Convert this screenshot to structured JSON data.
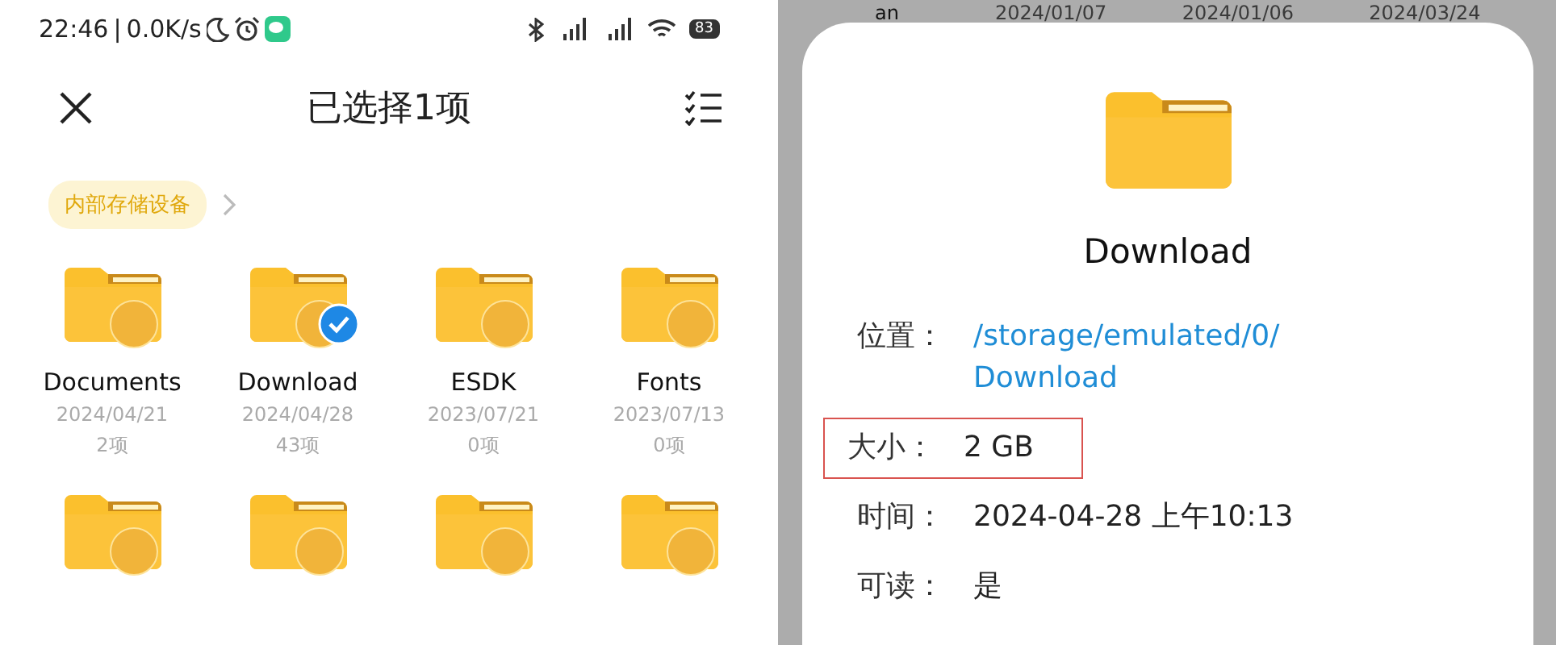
{
  "status_bar": {
    "time": "22:46",
    "separator": "|",
    "speed": "0.0K/s",
    "battery": "83"
  },
  "header": {
    "title": "已选择1项"
  },
  "breadcrumb": {
    "label": "内部存储设备"
  },
  "folders": [
    {
      "name": "Documents",
      "date": "2024/04/21",
      "count": "2项",
      "selected": false
    },
    {
      "name": "Download",
      "date": "2024/04/28",
      "count": "43项",
      "selected": true
    },
    {
      "name": "ESDK",
      "date": "2023/07/21",
      "count": "0项",
      "selected": false
    },
    {
      "name": "Fonts",
      "date": "2023/07/13",
      "count": "0项",
      "selected": false
    },
    {
      "selected": false
    },
    {
      "selected": false
    },
    {
      "selected": false
    },
    {
      "selected": false
    }
  ],
  "background_row": [
    "an",
    "2024/01/07",
    "2024/01/06",
    "2024/03/24"
  ],
  "details": {
    "title": "Download",
    "rows": [
      {
        "label": "位置：",
        "value": "/storage/emulated/0/Download",
        "kind": "link",
        "highlighted": false
      },
      {
        "label": "大小：",
        "value": "2 GB",
        "kind": "text",
        "highlighted": true
      },
      {
        "label": "时间：",
        "value": "2024-04-28 上午10:13",
        "kind": "text",
        "highlighted": false
      },
      {
        "label": "可读：",
        "value": "是",
        "kind": "text",
        "highlighted": false
      }
    ]
  }
}
